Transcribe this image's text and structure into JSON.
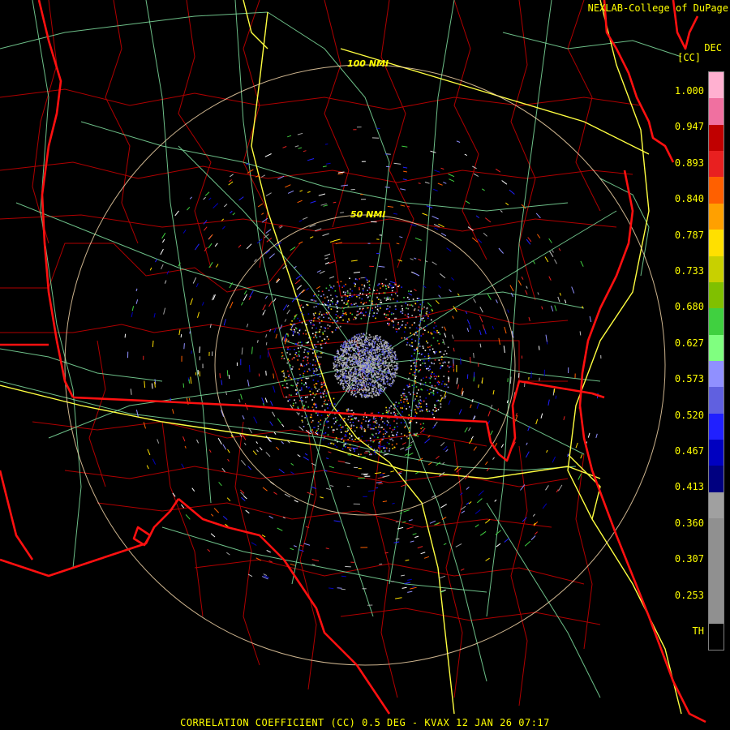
{
  "header": {
    "credit": "NEXLAB-College of DuPage",
    "unit_top": "DEC",
    "unit_bottom": "[CC]"
  },
  "footer": {
    "product_line": "CORRELATION COEFFICIENT (CC) 0.5 DEG - KVAX 12 JAN 26 07:17"
  },
  "range_rings": [
    {
      "label": "50 NMI"
    },
    {
      "label": "100 NMI"
    }
  ],
  "legend": {
    "labels": [
      "1.000",
      "0.947",
      "0.893",
      "0.840",
      "0.787",
      "0.733",
      "0.680",
      "0.627",
      "0.573",
      "0.520",
      "0.467",
      "0.413",
      "0.360",
      "0.307",
      "0.253",
      "TH"
    ],
    "colors": [
      "#ffb0d0",
      "#f070a0",
      "#c00000",
      "#e82020",
      "#ff6000",
      "#ffa000",
      "#ffe000",
      "#c8d000",
      "#80c000",
      "#40d040",
      "#80ff80",
      "#9090ff",
      "#6060e0",
      "#2020ff",
      "#0000c0",
      "#000080",
      "#a0a0a0",
      "#909090",
      "#909090",
      "#909090",
      "#909090",
      "#000000"
    ]
  },
  "colors": {
    "state_border": "#ff1010",
    "county_border": "#b00000",
    "highway": "#ffff40",
    "road": "#80e0a0",
    "range_ring": "#ffe0b0",
    "text": "#ffff00"
  }
}
